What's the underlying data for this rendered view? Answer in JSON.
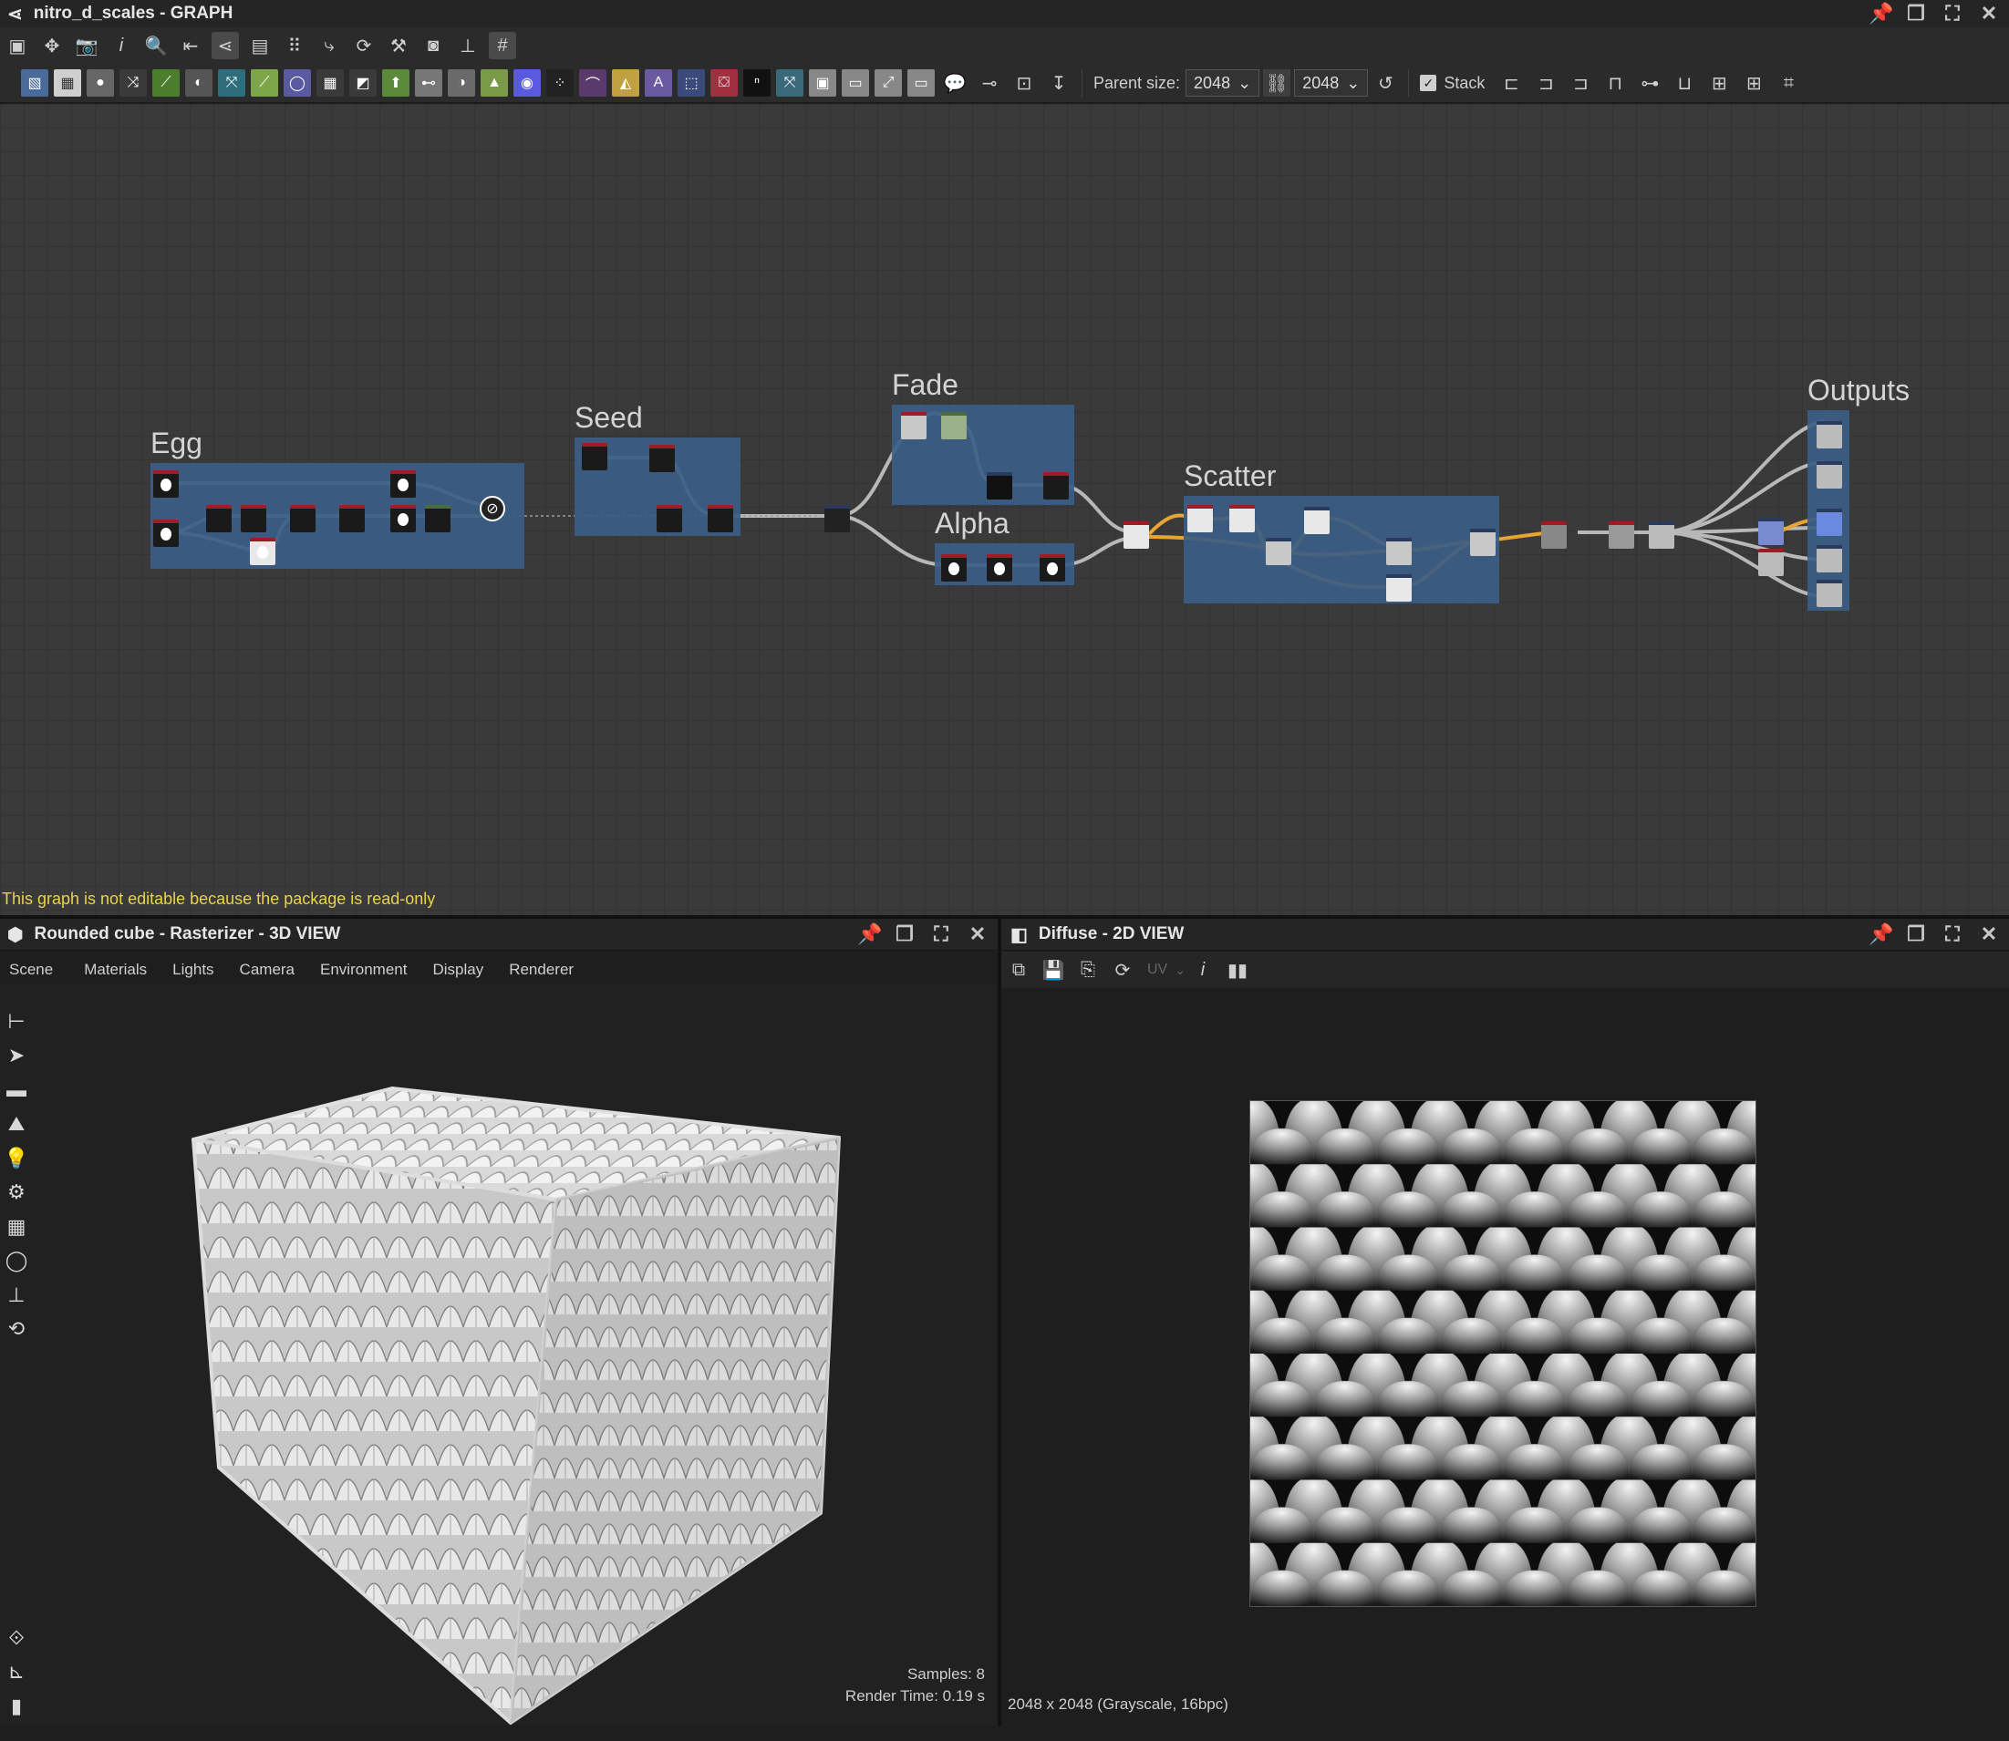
{
  "graph_panel": {
    "title": "nitro_d_scales - GRAPH",
    "read_only_message": "This graph is not editable because the package is read-only",
    "toolbar2": {
      "parent_size_label": "Parent size:",
      "parent_size_w": "2048",
      "parent_size_h": "2048",
      "stack_label": "Stack"
    },
    "frames": {
      "egg": "Egg",
      "seed": "Seed",
      "fade": "Fade",
      "alpha": "Alpha",
      "scatter": "Scatter",
      "outputs": "Outputs"
    }
  },
  "view3d": {
    "title": "Rounded cube - Rasterizer - 3D VIEW",
    "menu": [
      "Scene",
      "Materials",
      "Lights",
      "Camera",
      "Environment",
      "Display",
      "Renderer"
    ],
    "samples": "Samples: 8",
    "render_time": "Render Time: 0.19 s"
  },
  "view2d": {
    "title": "Diffuse - 2D VIEW",
    "uv_label": "UV",
    "status": "2048 x 2048 (Grayscale, 16bpc)"
  },
  "colors": {
    "frame": "#3b5d86",
    "warning_text": "#e8d34a",
    "wire_orange": "#e8a534",
    "wire_grey": "#b8b8b8"
  }
}
